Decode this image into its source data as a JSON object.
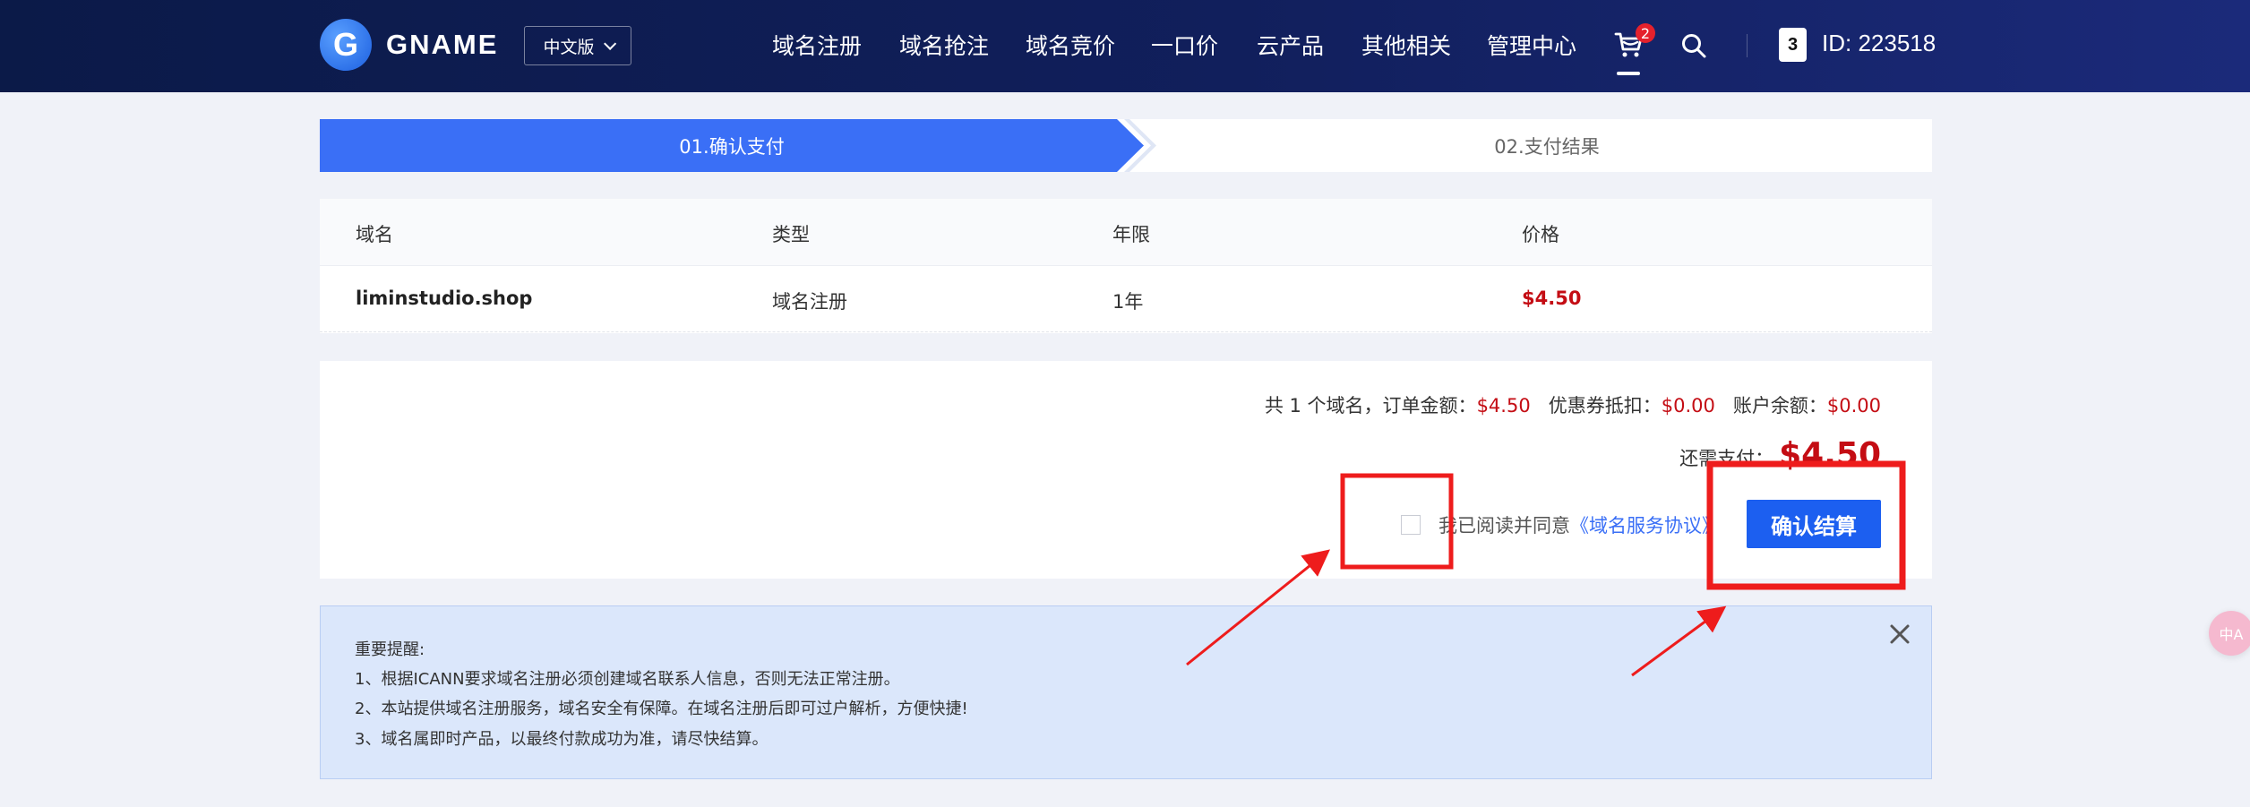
{
  "header": {
    "brand": "GNAME",
    "logo_letter": "G",
    "lang_label": "中文版",
    "nav": [
      "域名注册",
      "域名抢注",
      "域名竞价",
      "一口价",
      "云产品",
      "其他相关",
      "管理中心"
    ],
    "cart_count": "2",
    "id_card_letter": "3",
    "user_id": "ID: 223518"
  },
  "steps": {
    "active": "01.确认支付",
    "next": "02.支付结果"
  },
  "table": {
    "headers": [
      "域名",
      "类型",
      "年限",
      "价格"
    ],
    "rows": [
      {
        "domain": "liminstudio.shop",
        "type": "域名注册",
        "years": "1年",
        "price": "$4.50"
      }
    ]
  },
  "summary": {
    "count_label": "共 1 个域名，订单金额：",
    "order_amount": "$4.50",
    "coupon_label": "优惠券抵扣：",
    "coupon_amount": "$0.00",
    "balance_label": "账户余额：",
    "balance_amount": "$0.00",
    "need_pay_label": "还需支付：",
    "need_pay_amount": "$4.50",
    "agree_text": "我已阅读并同意",
    "agree_link": "《域名服务协议》",
    "agree_checked": false,
    "confirm_label": "确认结算"
  },
  "notice": {
    "title": "重要提醒:",
    "lines": [
      "1、根据ICANN要求域名注册必须创建域名联系人信息，否则无法正常注册。",
      "2、本站提供域名注册服务，域名安全有保障。在域名注册后即可过户解析，方便快捷!",
      "3、域名属即时产品，以最终付款成功为准，请尽快结算。"
    ]
  },
  "float_button": "中A",
  "colors": {
    "header": "#0b1a48",
    "accent": "#3a6ff6",
    "price_red": "#c40d14",
    "annotation_red": "#ee1c1c"
  }
}
